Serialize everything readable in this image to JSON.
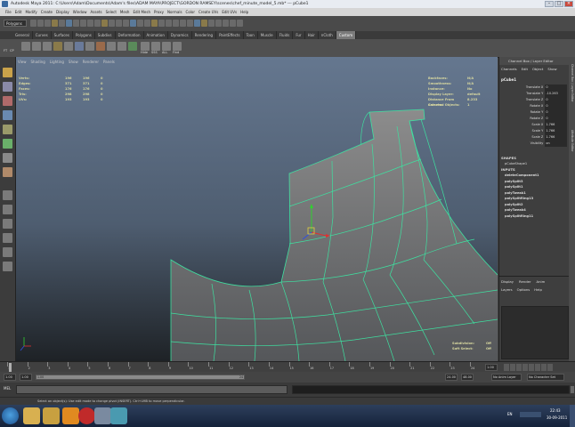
{
  "window": {
    "title": "Autodesk Maya 2011: C:\\Users\\Adam\\Documents\\Adam's files\\ADAM MAYA\\PROJECT\\GORDON RAMSEY\\scenes\\chef_minute_model_5.mb*  ---  pCube1"
  },
  "menubar": [
    "File",
    "Edit",
    "Modify",
    "Create",
    "Display",
    "Window",
    "Assets",
    "Select",
    "Mesh",
    "Edit Mesh",
    "Proxy",
    "Normals",
    "Color",
    "Create UVs",
    "Edit UVs",
    "Help"
  ],
  "statusline": {
    "mode": "Polygons"
  },
  "shelf_tabs": {
    "items": [
      "General",
      "Curves",
      "Surfaces",
      "Polygons",
      "Subdivs",
      "Deformation",
      "Animation",
      "Dynamics",
      "Rendering",
      "PaintEffects",
      "Toon",
      "Muscle",
      "Fluids",
      "Fur",
      "Hair",
      "nCloth",
      "Custom"
    ],
    "active": "Custom"
  },
  "shelf": {
    "left_labels": [
      "FT",
      "CP"
    ],
    "icon_labels": [
      "Hide",
      "SSS",
      "ALL",
      "Find"
    ]
  },
  "viewport": {
    "menu": [
      "View",
      "Shading",
      "Lighting",
      "Show",
      "Renderer",
      "Panels"
    ],
    "hud_left": [
      {
        "label": "Verts:",
        "a": "196",
        "b": "196",
        "c": "0"
      },
      {
        "label": "Edges:",
        "a": "371",
        "b": "371",
        "c": "0"
      },
      {
        "label": "Faces:",
        "a": "176",
        "b": "176",
        "c": "0"
      },
      {
        "label": "Tris:",
        "a": "298",
        "b": "298",
        "c": "0"
      },
      {
        "label": "UVs:",
        "a": "193",
        "b": "193",
        "c": "0"
      }
    ],
    "hud_right": [
      {
        "label": "Backfaces:",
        "value": "N/A"
      },
      {
        "label": "Smoothness:",
        "value": "N/A"
      },
      {
        "label": "Instance:",
        "value": "No"
      },
      {
        "label": "Display Layer:",
        "value": "default"
      },
      {
        "label": "Distance From Camera:",
        "value": "8.233"
      },
      {
        "label": "Selected Objects:",
        "value": "1"
      }
    ],
    "hud_bottom": [
      {
        "label": "Subdivision:",
        "value": "Off"
      },
      {
        "label": "Soft Select:",
        "value": "Off"
      }
    ]
  },
  "channel_box": {
    "title": "Channel Box / Layer Editor",
    "menus": [
      "Channels",
      "Edit",
      "Object",
      "Show"
    ],
    "object": "pCube1",
    "attributes": [
      {
        "name": "Translate X",
        "value": "0"
      },
      {
        "name": "Translate Y",
        "value": "-10.263"
      },
      {
        "name": "Translate Z",
        "value": "0"
      },
      {
        "name": "Rotate X",
        "value": "0"
      },
      {
        "name": "Rotate Y",
        "value": "0"
      },
      {
        "name": "Rotate Z",
        "value": "0"
      },
      {
        "name": "Scale X",
        "value": "1.766"
      },
      {
        "name": "Scale Y",
        "value": "1.766"
      },
      {
        "name": "Scale Z",
        "value": "1.766"
      },
      {
        "name": "Visibility",
        "value": "on"
      }
    ],
    "shapes_header": "SHAPES",
    "shapes": [
      "pCubeShape1"
    ],
    "inputs_header": "INPUTS",
    "inputs": [
      "deleteComponent1",
      "polySplit3",
      "polySplit1",
      "polyTweak1",
      "polySplitRing13",
      "polySplit2",
      "polyTweak4",
      "polySplitRing11"
    ],
    "side_tabs": [
      "Channel Box / Layer Editor",
      "Attribute Editor"
    ]
  },
  "layer_editor": {
    "tabs": [
      "Display",
      "Render",
      "Anim"
    ],
    "menus": [
      "Layers",
      "Options",
      "Help"
    ]
  },
  "timeline": {
    "ticks": [
      "1",
      "2",
      "3",
      "4",
      "5",
      "6",
      "7",
      "8",
      "9",
      "10",
      "11",
      "12",
      "13",
      "14",
      "15",
      "16",
      "17",
      "18",
      "19",
      "20",
      "21",
      "22",
      "23",
      "24"
    ],
    "current": "1.00"
  },
  "range": {
    "start": "1.00",
    "inner_start": "1.00",
    "inner_end": "24",
    "end": "24.00",
    "end2": "48.00",
    "anim_layer": "No Anim Layer",
    "char_set": "No Character Set"
  },
  "cmdline": {
    "lang": "MEL"
  },
  "help": {
    "text": "Select an object(s): Use edit mode to change pivot (INSERT). Ctrl+LMB to move perpendicular."
  },
  "taskbar": {
    "lang": "EN",
    "time": "22:43",
    "date": "30-09-2011"
  },
  "colors": {
    "wire": "#3ee0a0",
    "mesh_top": "#8a8a8a",
    "mesh_bottom": "#55575a",
    "hud": "#d8d8a0"
  }
}
